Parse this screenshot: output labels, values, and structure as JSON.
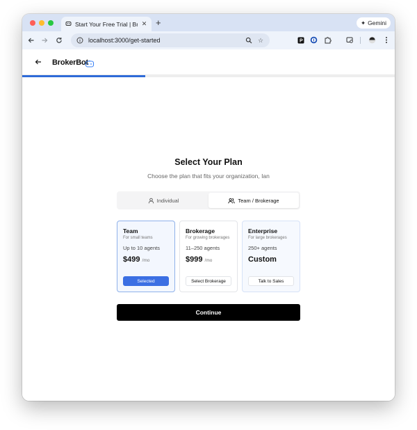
{
  "browser": {
    "tab_title": "Start Your Free Trial | BrokerБ",
    "tab_title_display": "Start Your Free Trial | BrokerB",
    "url": "localhost:3000/get-started",
    "gemini_label": "Gemini"
  },
  "app": {
    "brand": "BrokerBot",
    "progress_fraction": 0.33
  },
  "plan_page": {
    "title": "Select Your Plan",
    "subtitle": "Choose the plan that fits your organization, Ian",
    "toggle": {
      "options": [
        {
          "label": "Individual",
          "active": false
        },
        {
          "label": "Team / Brokerage",
          "active": true
        }
      ]
    },
    "plans": [
      {
        "name": "Team",
        "description": "For small teams",
        "agents": "Up to 10 agents",
        "price": "$499",
        "period": "/mo",
        "button": "Selected",
        "selected": true
      },
      {
        "name": "Brokerage",
        "description": "For growing brokerages",
        "agents": "11–250 agents",
        "price": "$999",
        "period": "/mo",
        "button": "Select Brokerage",
        "selected": false
      },
      {
        "name": "Enterprise",
        "description": "For large brokerages",
        "agents": "250+ agents",
        "price": "Custom",
        "period": "",
        "button": "Talk to Sales",
        "selected": false
      }
    ],
    "continue_label": "Continue"
  },
  "colors": {
    "accent": "#3b6fe3",
    "progress": "#2f6bd8",
    "primary_button": "#000000"
  }
}
